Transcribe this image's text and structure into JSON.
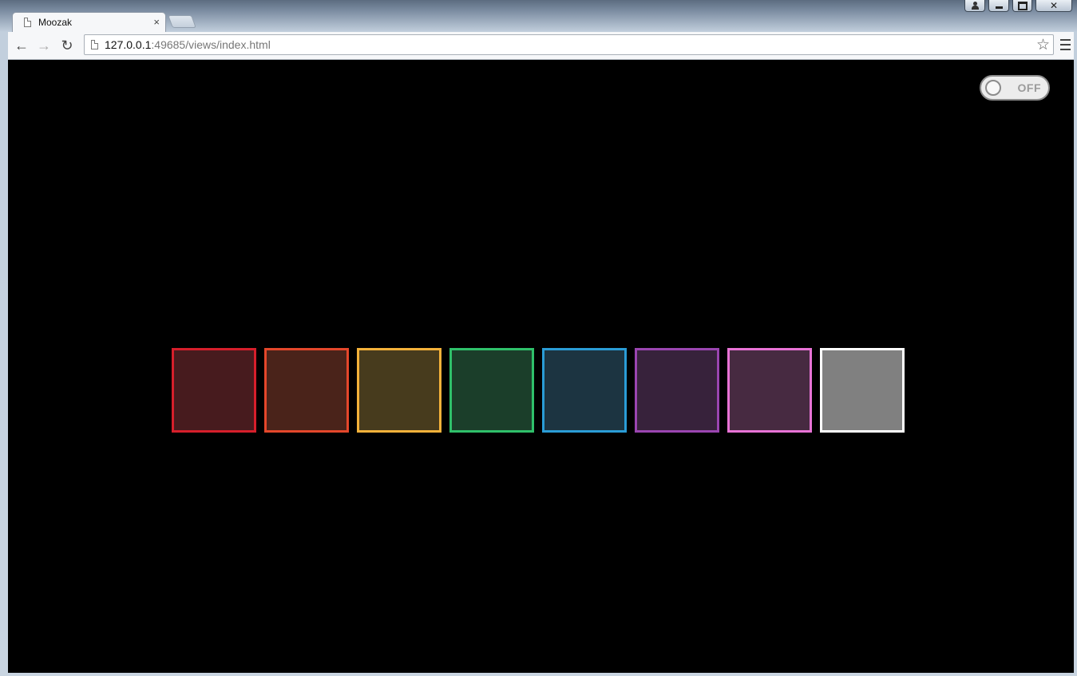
{
  "browser": {
    "tab_title": "Moozak",
    "tab_close": "×",
    "url_host": "127.0.0.1",
    "url_rest": ":49685/views/index.html",
    "back_glyph": "←",
    "forward_glyph": "→",
    "reload_glyph": "↻",
    "star_glyph": "☆"
  },
  "page": {
    "toggle": {
      "label": "OFF",
      "state": "off"
    },
    "pads": [
      {
        "name": "red",
        "border": "#d61f2b",
        "fill": "#471b1e"
      },
      {
        "name": "orange",
        "border": "#e4472b",
        "fill": "#4a231a"
      },
      {
        "name": "yellow",
        "border": "#f4b23a",
        "fill": "#473b1d"
      },
      {
        "name": "green",
        "border": "#2fc06a",
        "fill": "#1b3e2a"
      },
      {
        "name": "blue",
        "border": "#2a9cd6",
        "fill": "#1c3441"
      },
      {
        "name": "purple",
        "border": "#9a45b0",
        "fill": "#37223b"
      },
      {
        "name": "pink",
        "border": "#e873d6",
        "fill": "#472a41"
      },
      {
        "name": "white",
        "border": "#ffffff",
        "fill": "#808080"
      }
    ]
  }
}
